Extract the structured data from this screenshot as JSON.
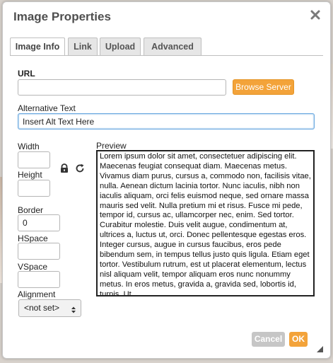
{
  "dialog": {
    "title": "Image Properties",
    "close_icon": "close-icon"
  },
  "tabs": [
    {
      "label": "Image Info",
      "active": true
    },
    {
      "label": "Link",
      "active": false
    },
    {
      "label": "Upload",
      "active": false
    },
    {
      "label": "Advanced",
      "active": false
    }
  ],
  "url": {
    "label": "URL",
    "value": "",
    "browse_button": "Browse Server"
  },
  "alt_text": {
    "label": "Alternative Text",
    "value": "Insert Alt Text Here"
  },
  "width": {
    "label": "Width",
    "value": ""
  },
  "height": {
    "label": "Height",
    "value": ""
  },
  "lock_icon": "lock-icon",
  "reset_icon": "reset-size-icon",
  "border": {
    "label": "Border",
    "value": "0"
  },
  "hspace": {
    "label": "HSpace",
    "value": ""
  },
  "vspace": {
    "label": "VSpace",
    "value": ""
  },
  "alignment": {
    "label": "Alignment",
    "value": "<not set>"
  },
  "preview": {
    "label": "Preview",
    "text": "Lorem ipsum dolor sit amet, consectetuer adipiscing elit. Maecenas feugiat consequat diam. Maecenas metus. Vivamus diam purus, cursus a, commodo non, facilisis vitae, nulla. Aenean dictum lacinia tortor. Nunc iaculis, nibh non iaculis aliquam, orci felis euismod neque, sed ornare massa mauris sed velit. Nulla pretium mi et risus. Fusce mi pede, tempor id, cursus ac, ullamcorper nec, enim. Sed tortor. Curabitur molestie. Duis velit augue, condimentum at, ultrices a, luctus ut, orci. Donec pellentesque egestas eros. Integer cursus, augue in cursus faucibus, eros pede bibendum sem, in tempus tellus justo quis ligula. Etiam eget tortor. Vestibulum rutrum, est ut placerat elementum, lectus nisl aliquam velit, tempor aliquam eros nunc nonummy metus. In eros metus, gravida a, gravida sed, lobortis id, turpis. Ut"
  },
  "footer": {
    "cancel": "Cancel",
    "ok": "OK"
  },
  "colors": {
    "accent": "#f3a33a",
    "focus": "#6aa9e0"
  }
}
